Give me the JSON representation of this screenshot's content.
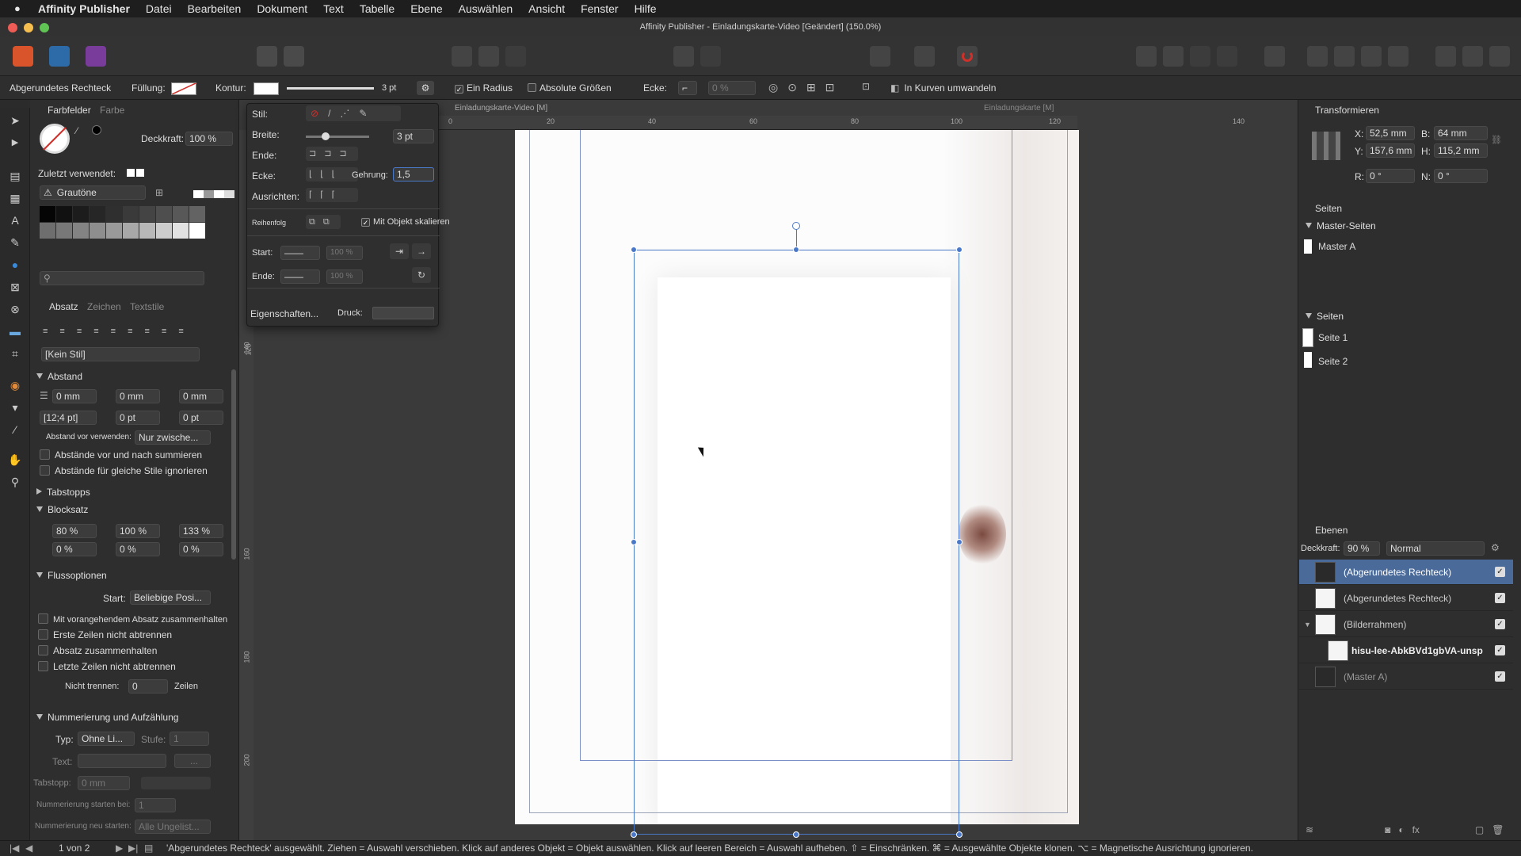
{
  "menubar": {
    "items": [
      "Affinity Publisher",
      "Datei",
      "Bearbeiten",
      "Dokument",
      "Text",
      "Tabelle",
      "Ebene",
      "Auswählen",
      "Ansicht",
      "Fenster",
      "Hilfe"
    ]
  },
  "window": {
    "title": "Affinity Publisher - Einladungskarte-Video [Geändert] (150.0%)"
  },
  "context": {
    "object": "Abgerundetes Rechteck",
    "fill_label": "Füllung:",
    "stroke_label": "Kontur:",
    "stroke_size": "3 pt",
    "one_radius": "Ein Radius",
    "absolute_sizes": "Absolute Größen",
    "corner_label": "Ecke:",
    "corner_value": "0 %",
    "convert": "In Kurven umwandeln"
  },
  "swatches": {
    "tab_swatches": "Farbfelder",
    "tab_color": "Farbe",
    "opacity_label": "Deckkraft:",
    "opacity_value": "100 %",
    "recent_label": "Zuletzt verwendet:",
    "palette": "Grautöne"
  },
  "paragraph": {
    "tab_paragraph": "Absatz",
    "tab_character": "Zeichen",
    "tab_textstyles": "Textstile",
    "style": "[Kein Stil]",
    "spacing_title": "Abstand",
    "indent_left": "0 mm",
    "indent_right": "0 mm",
    "indent_first": "0 mm",
    "leading": "[12;4 pt]",
    "space_before": "0 pt",
    "space_after": "0 pt",
    "space_before_use_label": "Abstand vor verwenden:",
    "space_before_use_value": "Nur zwische...",
    "cb_sum": "Abstände vor und nach summieren",
    "cb_ignore": "Abstände für gleiche Stile ignorieren",
    "tabs_title": "Tabstopps",
    "justify_title": "Blocksatz",
    "word_min": "80 %",
    "word_desired": "100 %",
    "word_max": "133 %",
    "letter_min": "0 %",
    "letter_desired": "0 %",
    "letter_max": "0 %",
    "flow_title": "Flussoptionen",
    "start_label": "Start:",
    "start_value": "Beliebige Posi...",
    "cb_keep_prev": "Mit vorangehendem Absatz zusammenhalten",
    "cb_first_lines": "Erste Zeilen nicht abtrennen",
    "cb_keep_together": "Absatz zusammenhalten",
    "cb_last_lines": "Letzte Zeilen nicht abtrennen",
    "no_break_label": "Nicht trennen:",
    "no_break_value": "0",
    "no_break_unit": "Zeilen",
    "numbering_title": "Nummerierung und Aufzählung",
    "type_label": "Typ:",
    "type_value": "Ohne Li...",
    "level_label": "Stufe:",
    "level_value": "1",
    "text_label": "Text:",
    "text_more": "...",
    "tabstop_label": "Tabstopp:",
    "tabstop_value": "0 mm",
    "start_num_label": "Nummerierung starten bei:",
    "start_num_value": "1",
    "restart_label": "Nummerierung neu starten:",
    "restart_value": "Alle Ungelist..."
  },
  "stroke_popup": {
    "style_label": "Stil:",
    "width_label": "Breite:",
    "width_value": "3 pt",
    "end_label": "Ende:",
    "corner_label": "Ecke:",
    "miter_label": "Gehrung:",
    "miter_value": "1,5",
    "align_label": "Ausrichten:",
    "order_label": "Reihenfolg",
    "scale_label": "Mit Objekt skalieren",
    "start_label": "Start:",
    "start_pct": "100 %",
    "end2_label": "Ende:",
    "end2_pct": "100 %",
    "properties": "Eigenschaften...",
    "pressure": "Druck:"
  },
  "rulers": {
    "tab1": "Einladungskarte-Video [M]",
    "tab2": "Einladungskarte [M]",
    "h_ticks": [
      "0",
      "20",
      "40",
      "60",
      "80",
      "100",
      "120",
      "140"
    ],
    "v_ticks": [
      "120",
      "140",
      "160",
      "180",
      "200"
    ]
  },
  "transform": {
    "title": "Transformieren",
    "x_label": "X:",
    "x_value": "52,5 mm",
    "y_label": "Y:",
    "y_value": "157,6 mm",
    "b_label": "B:",
    "b_value": "64 mm",
    "h_label": "H:",
    "h_value": "115,2 mm",
    "r_label": "R:",
    "r_value": "0 °",
    "n_label": "N:",
    "n_value": "0 °"
  },
  "pages": {
    "title": "Seiten",
    "master_section": "Master-Seiten",
    "master_a": "Master A",
    "pages_section": "Seiten",
    "page1": "Seite 1",
    "page2": "Seite 2"
  },
  "layers": {
    "title": "Ebenen",
    "opacity_label": "Deckkraft:",
    "opacity_value": "90 %",
    "blend": "Normal",
    "items": [
      "(Abgerundetes Rechteck)",
      "(Abgerundetes Rechteck)",
      "(Bilderrahmen)",
      "hisu-lee-AbkBVd1gbVA-unsp",
      "(Master A)"
    ]
  },
  "status": {
    "page_indicator": "1 von 2",
    "message": "'Abgerundetes Rechteck' ausgewählt. Ziehen = Auswahl verschieben. Klick auf anderes Objekt = Objekt auswählen. Klick auf leeren Bereich = Auswahl aufheben. ⇧ = Einschränken. ⌘ = Ausgewählte Objekte klonen. ⌥ = Magnetische Ausrichtung ignorieren."
  },
  "colors": {
    "selection": "#4a78c8",
    "highlight_row": "#4a6a9a",
    "accent_red": "#d0302a"
  }
}
